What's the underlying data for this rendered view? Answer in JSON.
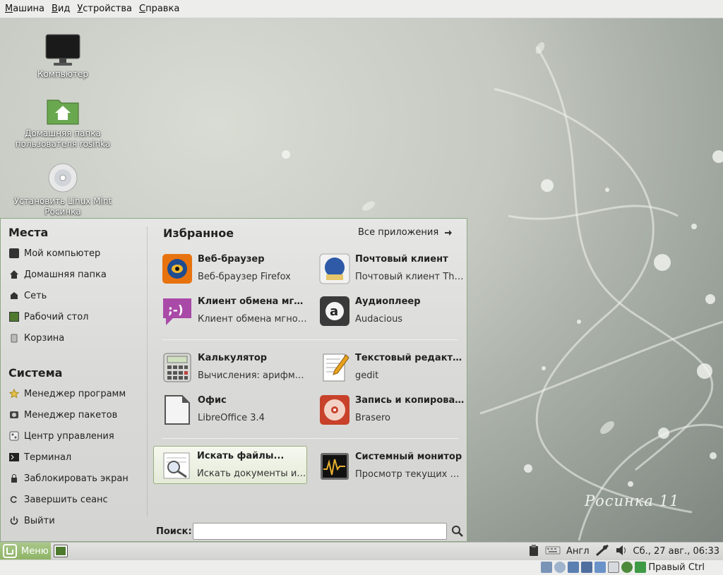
{
  "vm_menubar": {
    "items": [
      "Машина",
      "Вид",
      "Устройства",
      "Справка"
    ]
  },
  "desktop": {
    "icons": [
      {
        "label": "Компьютер",
        "icon": "monitor-icon"
      },
      {
        "label": "Домашняя папка пользователя rosinka",
        "icon": "home-folder-icon"
      },
      {
        "label": "Установить Linux Mint Росинка",
        "icon": "disc-icon"
      }
    ],
    "brand": "Росинка 11"
  },
  "menu": {
    "places": {
      "title": "Места",
      "items": [
        "Мой компьютер",
        "Домашняя папка",
        "Сеть",
        "Рабочий стол",
        "Корзина"
      ]
    },
    "system": {
      "title": "Система",
      "items": [
        "Менеджер программ",
        "Менеджер пакетов",
        "Центр управления",
        "Терминал",
        "Заблокировать экран",
        "Завершить сеанс",
        "Выйти"
      ]
    },
    "favorites": {
      "title": "Избранное",
      "all_apps": "Все приложения",
      "apps": [
        {
          "name": "Веб-браузер",
          "desc": "Веб-браузер Firefox",
          "icon": "firefox-icon"
        },
        {
          "name": "Почтовый клиент",
          "desc": "Почтовый клиент Thu...",
          "icon": "thunderbird-icon"
        },
        {
          "name": "Клиент обмена мгно...",
          "desc": "Клиент обмена мгнов...",
          "icon": "chat-icon"
        },
        {
          "name": "Аудиоплеер",
          "desc": "Audacious",
          "icon": "audacious-icon"
        },
        {
          "name": "Калькулятор",
          "desc": "Вычисления: арифмет...",
          "icon": "calculator-icon"
        },
        {
          "name": "Текстовый редактор",
          "desc": "gedit",
          "icon": "text-editor-icon"
        },
        {
          "name": "Офис",
          "desc": "LibreOffice 3.4",
          "icon": "office-icon"
        },
        {
          "name": "Запись и копирован...",
          "desc": "Brasero",
          "icon": "brasero-icon"
        },
        {
          "name": "Искать файлы...",
          "desc": "Искать документы и п...",
          "icon": "search-files-icon"
        },
        {
          "name": "Системный монитор",
          "desc": "Просмотр текущих пр...",
          "icon": "system-monitor-icon"
        }
      ]
    },
    "search": {
      "label": "Поиск:",
      "value": ""
    }
  },
  "panel": {
    "menu_label": "Меню",
    "keyboard_layout": "Англ",
    "clock": "Сб., 27 авг., 06:33"
  },
  "vm_status": {
    "host_key": "Правый Ctrl"
  }
}
